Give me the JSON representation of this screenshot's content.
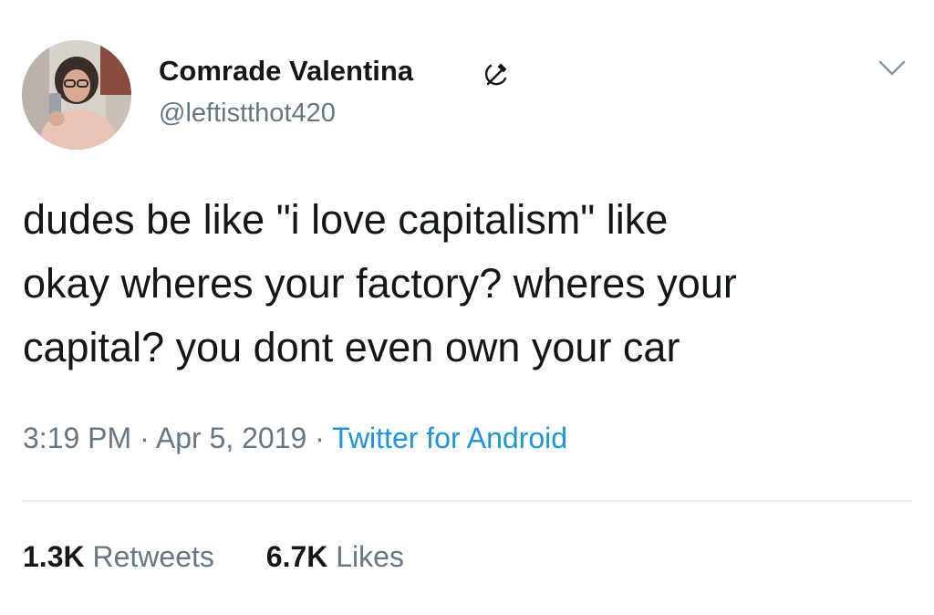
{
  "author": {
    "display_name": "Comrade Valentina",
    "name_emoji": "hammer-and-sickle-icon",
    "handle": "@leftistthot420"
  },
  "tweet": {
    "text": "dudes be like \"i love capitalism\" like\nokay wheres your factory? wheres your\ncapital? you dont even own your car",
    "time": "3:19 PM",
    "date": "Apr 5, 2019",
    "separator": " · ",
    "source": "Twitter for Android"
  },
  "stats": {
    "retweets_count": "1.3K",
    "retweets_label": "Retweets",
    "likes_count": "6.7K",
    "likes_label": "Likes"
  },
  "colors": {
    "text": "#14171a",
    "secondary": "#657786",
    "link": "#1b95e0",
    "divider": "#e6ecf0"
  }
}
